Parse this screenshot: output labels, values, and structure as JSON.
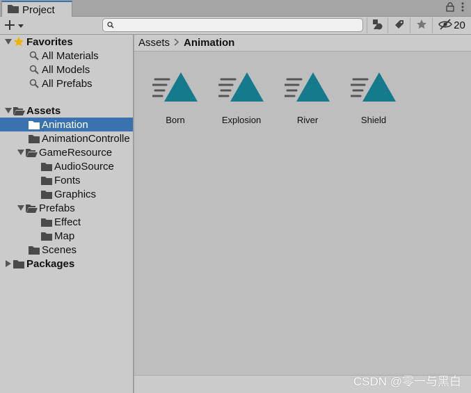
{
  "tab": {
    "label": "Project",
    "icon": "folder-icon"
  },
  "toolbar": {
    "add_icon": "plus-icon",
    "search_placeholder": "",
    "hidden_count": "20"
  },
  "tree": {
    "favorites": {
      "label": "Favorites",
      "items": [
        "All Materials",
        "All Models",
        "All Prefabs"
      ]
    },
    "assets": {
      "label": "Assets",
      "animation": "Animation",
      "animation_controllers": "AnimationControlle",
      "game_resource": "GameResource",
      "audio_source": "AudioSource",
      "fonts": "Fonts",
      "graphics": "Graphics",
      "prefabs": "Prefabs",
      "effect": "Effect",
      "map": "Map",
      "scenes": "Scenes"
    },
    "packages": "Packages"
  },
  "breadcrumb": {
    "root": "Assets",
    "current": "Animation"
  },
  "assets_grid": [
    {
      "name": "Born",
      "icon": "animation-clip-icon"
    },
    {
      "name": "Explosion",
      "icon": "animation-clip-icon"
    },
    {
      "name": "River",
      "icon": "animation-clip-icon"
    },
    {
      "name": "Shield",
      "icon": "animation-clip-icon"
    }
  ],
  "watermark": "CSDN @零一与黑白",
  "colors": {
    "selection": "#3a72b0",
    "clip_icon": "#147a8c",
    "favorite_star": "#f0b300"
  }
}
